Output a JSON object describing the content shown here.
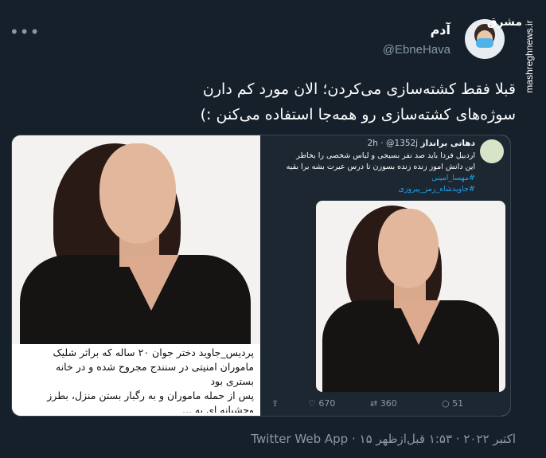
{
  "author": {
    "name": "آدم",
    "handle": "@EbneHava"
  },
  "watermark": {
    "logo_text": "مشرق",
    "site": "mashreghnews.ir"
  },
  "tweet": {
    "text_line1": "قبلا فقط کشته‌سازی می‌کردن؛ الان مورد کم دارن",
    "text_line2": "سوژه‌های کشته‌سازی رو همه‌جا استفاده می‌کنن :)"
  },
  "media": {
    "caption_line1": "پردیس_جاوید دختر جوان ۲۰ ساله که براثر شلیک",
    "caption_line2": "ماموران امنیتی در سنندج مجروح شده و در خانه",
    "caption_line3": "بستری بود",
    "caption_line4": "پس از حمله ماموران و به رگبار بستن منزل، بطرز",
    "caption_line5": "وحشیانه ای به ...",
    "quoted": {
      "name": "دهاتی برانداز",
      "handle": "@1352j",
      "time": "2h",
      "line1": "اردبیل فردا باید صد نفر بسیجی و لباس شخصی را  بخاطر",
      "line2": "این دانش اموز زنده زنده بسوزن  تا درس عبرت بشه برا بقیه",
      "tag1": "#مهسا_امینی",
      "tag2": "#جاویدشاه_رمز_پیروزی",
      "replies": "51",
      "retweets": "360",
      "likes": "670"
    }
  },
  "meta": {
    "time": "۱:۵۳ قبل‌ازظهر",
    "date": "۱۵ اکتبر ۲۰۲۲",
    "separator": "·",
    "source": "Twitter Web App"
  },
  "colors": {
    "background": "#15202b",
    "secondary_text": "#8899a6",
    "link": "#1da1f2"
  }
}
